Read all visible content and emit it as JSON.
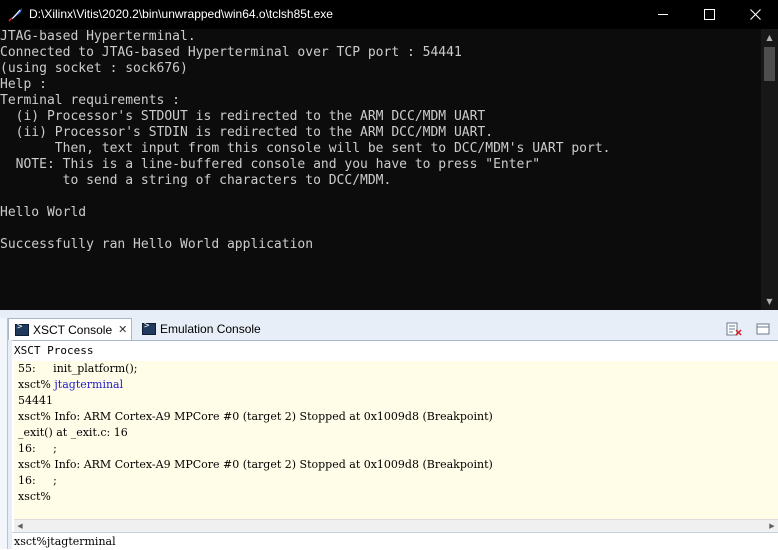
{
  "window": {
    "title": "D:\\Xilinx\\Vitis\\2020.2\\bin\\unwrapped\\win64.o\\tclsh85t.exe",
    "controls": {
      "minimize": "minimize-icon",
      "maximize": "maximize-icon",
      "close": "close-icon"
    }
  },
  "terminal_lines": [
    "JTAG-based Hyperterminal.",
    "Connected to JTAG-based Hyperterminal over TCP port : 54441",
    "(using socket : sock676)",
    "Help :",
    "Terminal requirements :",
    "  (i) Processor's STDOUT is redirected to the ARM DCC/MDM UART",
    "  (ii) Processor's STDIN is redirected to the ARM DCC/MDM UART.",
    "       Then, text input from this console will be sent to DCC/MDM's UART port.",
    "  NOTE: This is a line-buffered console and you have to press \"Enter\"",
    "        to send a string of characters to DCC/MDM.",
    "",
    "Hello World",
    "",
    "Successfully ran Hello World application"
  ],
  "tabs": [
    {
      "label": "XSCT Console",
      "active": true,
      "icon": "terminal-icon",
      "close": "✕"
    },
    {
      "label": "Emulation Console",
      "active": false,
      "icon": "terminal-icon"
    }
  ],
  "process_label": "XSCT Process",
  "console_log": [
    {
      "prompt": "",
      "text": "55:     init_platform();"
    },
    {
      "prompt": "xsct% ",
      "text": "jtagterminal",
      "is_command": true
    },
    {
      "prompt": "",
      "text": "54441"
    },
    {
      "prompt": "",
      "text": "xsct% Info: ARM Cortex-A9 MPCore #0 (target 2) Stopped at 0x1009d8 (Breakpoint)"
    },
    {
      "prompt": "",
      "text": "_exit() at _exit.c: 16"
    },
    {
      "prompt": "",
      "text": "16:     ;"
    },
    {
      "prompt": "",
      "text": "xsct% Info: ARM Cortex-A9 MPCore #0 (target 2) Stopped at 0x1009d8 (Breakpoint)"
    },
    {
      "prompt": "",
      "text": "16:     ;"
    },
    {
      "prompt": "xsct% ",
      "text": ""
    }
  ],
  "input": {
    "value": "xsct%jtagterminal"
  },
  "colors": {
    "console_bg": "#0c0c0c",
    "console_fg": "#cccccc",
    "log_bg": "#fffde8",
    "command_blue": "#2020c8",
    "pane_bg": "#e8eef7"
  }
}
